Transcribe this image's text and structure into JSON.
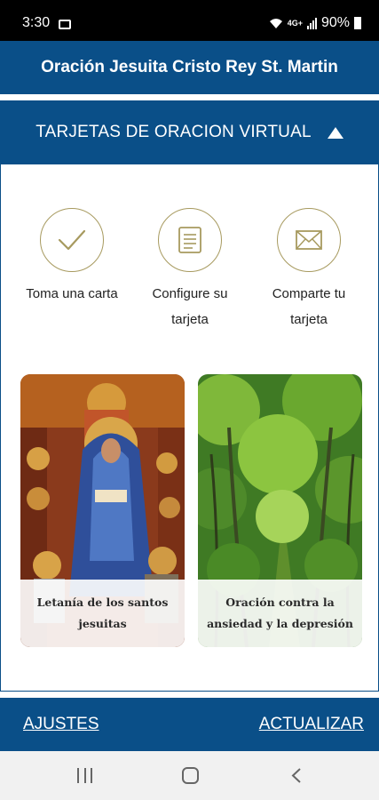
{
  "status": {
    "time": "3:30",
    "network": "4G+",
    "battery": "90%"
  },
  "app": {
    "title": "Oración Jesuita Cristo Rey St. Martin"
  },
  "section": {
    "title": "TARJETAS DE ORACION VIRTUAL",
    "toggle_icon": "triangle-up-icon"
  },
  "steps": [
    {
      "label": "Toma una carta",
      "icon": "checkmark-icon"
    },
    {
      "label": "Configure su tarjeta",
      "icon": "card-icon"
    },
    {
      "label": "Comparte tu tarjeta",
      "icon": "envelope-icon"
    }
  ],
  "cards": [
    {
      "caption": "Letanía de los santos jesuitas"
    },
    {
      "caption": "Oración contra la ansiedad y la depresión"
    }
  ],
  "footer": {
    "settings": "AJUSTES",
    "update": "ACTUALIZAR"
  },
  "colors": {
    "brand_blue": "#0a4f88",
    "icon_gold": "#a79a5f"
  }
}
